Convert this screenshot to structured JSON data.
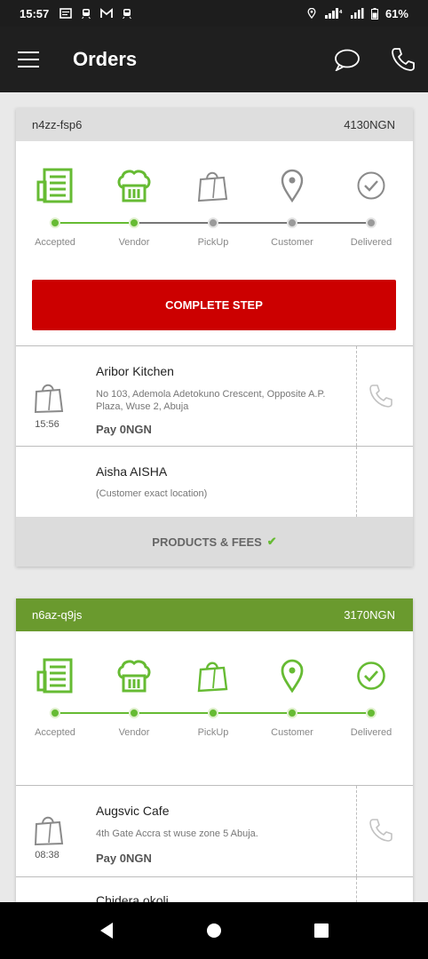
{
  "status_bar": {
    "time": "15:57",
    "battery": "61%",
    "icons": [
      "message-icon",
      "train-icon",
      "gmail-icon",
      "train-icon",
      "location-icon",
      "wifi-icon",
      "signal-icon",
      "battery-icon"
    ]
  },
  "app_bar": {
    "title": "Orders",
    "icons": [
      "menu-icon",
      "chat-icon",
      "phone-icon"
    ]
  },
  "steps_labels": [
    "Accepted",
    "Vendor",
    "PickUp",
    "Customer",
    "Delivered"
  ],
  "orders": [
    {
      "id": "n4zz-fsp6",
      "amount": "4130NGN",
      "header_color": "#dedede",
      "progress_done": 2,
      "button_label": "COMPLETE STEP",
      "vendor": {
        "name": "Aribor Kitchen",
        "address": "No 103, Ademola Adetokuno Crescent, Opposite A.P. Plaza, Wuse 2, Abuja",
        "time": "15:56",
        "pay": "Pay 0NGN"
      },
      "customer": {
        "name": "Aisha AISHA",
        "address": "(Customer exact location)"
      },
      "products_label": "PRODUCTS & FEES",
      "products_check": "✔"
    },
    {
      "id": "n6az-q9js",
      "amount": "3170NGN",
      "header_color": "#6a9a2e",
      "progress_done": 5,
      "vendor": {
        "name": "Augsvic Cafe",
        "address": "4th Gate Accra st wuse zone 5 Abuja.",
        "time": "08:38",
        "pay": "Pay 0NGN"
      },
      "customer": {
        "name": "Chidera okoli"
      }
    }
  ],
  "colors": {
    "accent_green": "#66bb33",
    "danger_red": "#cc0000",
    "inactive_grey": "#9a9a9a"
  },
  "nav": [
    "back-icon",
    "home-icon",
    "recents-icon"
  ]
}
